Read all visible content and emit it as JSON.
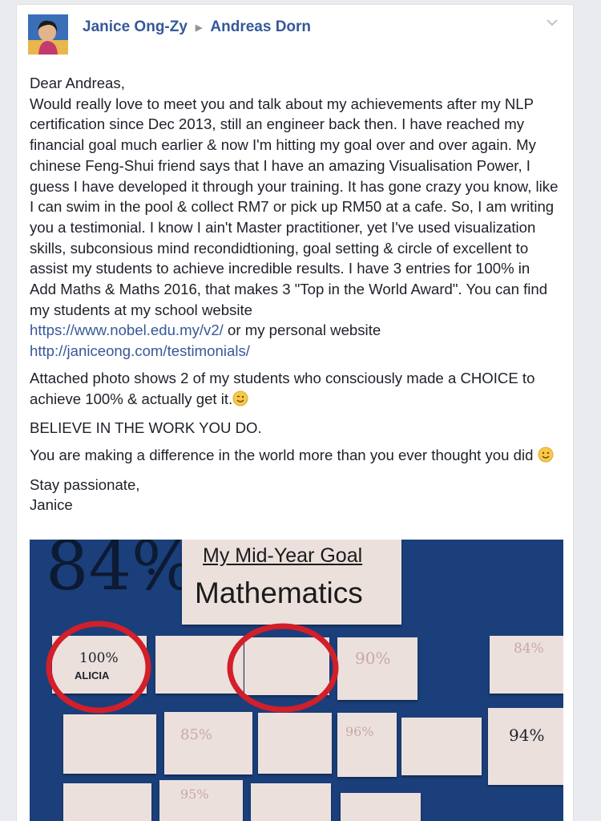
{
  "post": {
    "author": "Janice Ong-Zy",
    "target": "Andreas Dorn",
    "greeting": "Dear Andreas,",
    "paragraph_main": "Would really love to meet you and talk about my achievements after my NLP certification since Dec 2013, still an engineer back then. I have reached my financial goal much earlier & now I'm hitting my goal over and over again. My chinese Feng-Shui friend says that I have an amazing Visualisation Power, I guess I have developed it through your training. It has gone crazy you know, like I can swim in the pool & collect RM7 or pick up RM50 at a cafe. So, I am writing you a testimonial. I know I ain't Master practitioner, yet I've used visualization skills, subconsious mind recondidtioning, goal setting & circle of excellent to assist my students to achieve incredible results. I have 3 entries for 100% in Add Maths & Maths 2016, that makes 3 \"Top in the World Award\". You can find my students at my school website",
    "link_school": "https://www.nobel.edu.my/v2/",
    "link_joiner": " or my personal website",
    "link_personal": "http://janiceong.com/testimonials/",
    "paragraph_photo": "Attached photo shows 2 of my students who consciously made a CHOICE to achieve 100% & actually get it.",
    "paragraph_believe": "BELIEVE IN THE WORK YOU DO.",
    "paragraph_difference": "You are making a difference in the world more than you ever thought you did",
    "signoff_1": "Stay passionate,",
    "signoff_2": "Janice",
    "icons": {
      "expand": "chevron-down-icon",
      "separator": "triangle-right-icon",
      "emoji_wink": "winking-face-icon",
      "emoji_smile": "smiling-face-icon"
    },
    "colors": {
      "link": "#365899",
      "text": "#1d2129",
      "background": "#e9ebee",
      "board": "#1a3f7a",
      "circle": "#d21f2a"
    }
  },
  "photo": {
    "big_number": "84%",
    "title_line1": "My Mid-Year Goal",
    "title_line2": "Mathematics",
    "note_1_score": "100%",
    "note_1_name": "ALICIA",
    "note_2_score": "90%",
    "note_3_score": "84%",
    "note_4_score": "94%",
    "note_5_score": "85%",
    "note_6_score": "96%",
    "note_7_score": "95%"
  }
}
